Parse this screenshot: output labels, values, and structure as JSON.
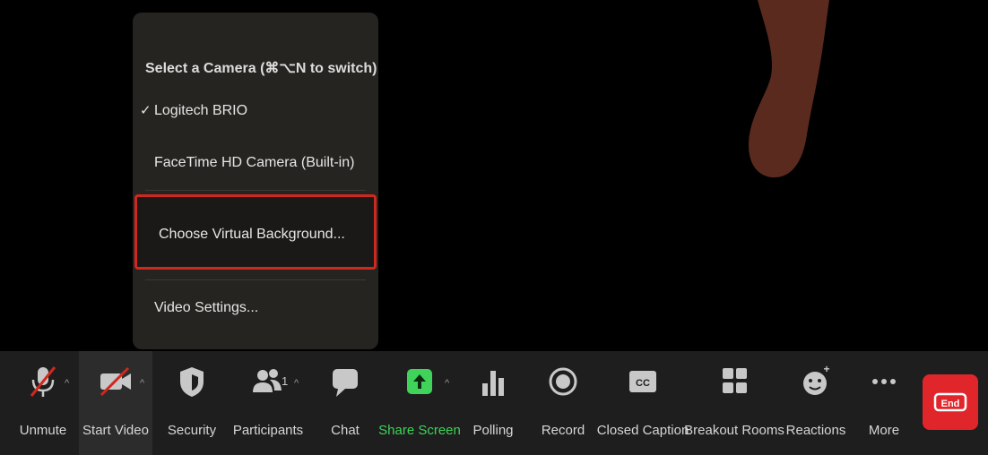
{
  "camera_menu": {
    "header": "Select a Camera (⌘⌥N to switch)",
    "items": [
      {
        "label": "Logitech BRIO",
        "checked": true
      },
      {
        "label": "FaceTime HD Camera (Built-in)",
        "checked": false
      },
      {
        "label": "Choose Virtual Background...",
        "highlighted": true
      },
      {
        "label": "Video Settings..."
      }
    ],
    "check_mark": "✓"
  },
  "toolbar": {
    "items": [
      {
        "label": "Unmute",
        "icon": "muted-mic-icon"
      },
      {
        "label": "Start Video",
        "icon": "video-off-icon"
      },
      {
        "label": "Security",
        "icon": "shield-icon"
      },
      {
        "label": "Participants",
        "icon": "participants-icon",
        "count": "1"
      },
      {
        "label": "Chat",
        "icon": "chat-icon"
      },
      {
        "label": "Share Screen",
        "icon": "share-screen-icon"
      },
      {
        "label": "Polling",
        "icon": "polling-icon"
      },
      {
        "label": "Record",
        "icon": "record-icon"
      },
      {
        "label": "Closed Caption",
        "icon": "cc-icon"
      },
      {
        "label": "Breakout Rooms",
        "icon": "breakout-rooms-icon"
      },
      {
        "label": "Reactions",
        "icon": "reactions-icon"
      },
      {
        "label": "More",
        "icon": "more-icon"
      }
    ],
    "end_button": {
      "label": "End",
      "icon": "end-icon"
    }
  },
  "colors": {
    "highlight_border": "#d0281e",
    "share_green": "#3fd35a",
    "end_red": "#e0262b"
  }
}
